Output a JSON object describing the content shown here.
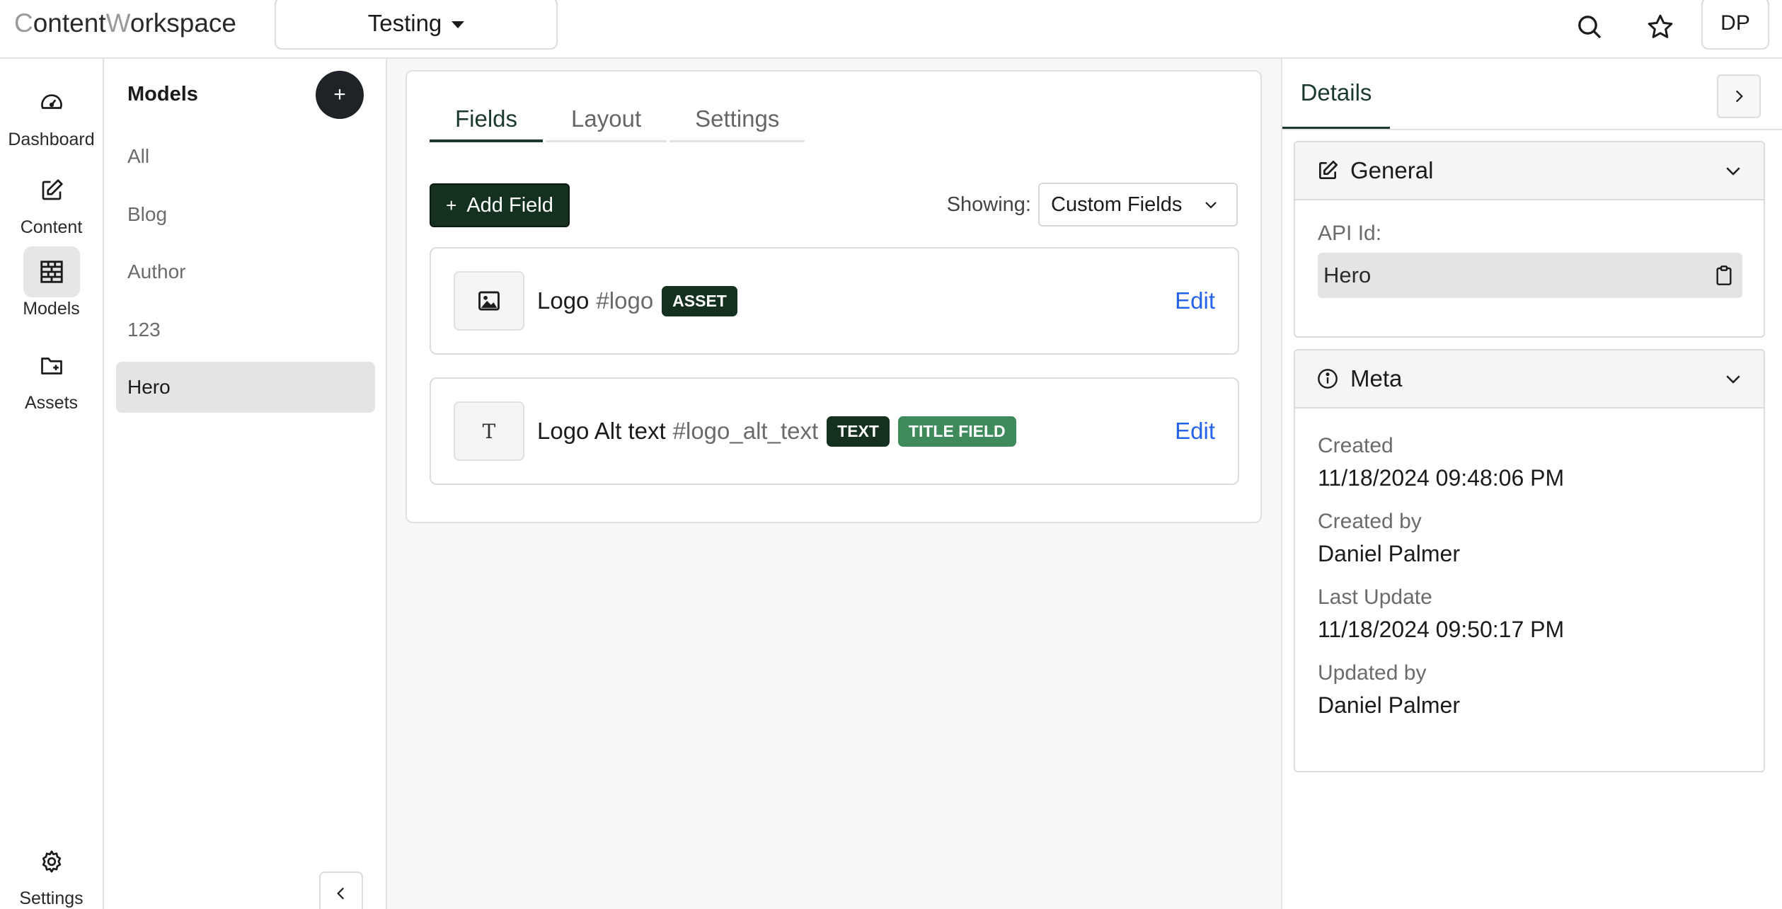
{
  "app": {
    "logo_prefix": "C",
    "logo_mid": "ontent",
    "logo_w": "W",
    "logo_suffix": "orkspace",
    "project": "Testing",
    "avatar_initials": "DP"
  },
  "nav": {
    "dashboard": "Dashboard",
    "content": "Content",
    "models": "Models",
    "assets": "Assets",
    "settings": "Settings"
  },
  "models_panel": {
    "title": "Models",
    "add_label": "+",
    "items": [
      {
        "label": "All"
      },
      {
        "label": "Blog"
      },
      {
        "label": "Author"
      },
      {
        "label": "123"
      },
      {
        "label": "Hero"
      }
    ],
    "active": "Hero"
  },
  "main": {
    "tabs": [
      {
        "label": "Fields"
      },
      {
        "label": "Layout"
      },
      {
        "label": "Settings"
      }
    ],
    "active_tab": "Fields",
    "add_field_plus": "+",
    "add_field_label": "Add Field",
    "showing_label": "Showing:",
    "showing_value": "Custom Fields",
    "fields": [
      {
        "icon": "image-icon",
        "name": "Logo",
        "key": "#logo",
        "badges": [
          "ASSET"
        ],
        "edit": "Edit"
      },
      {
        "icon_text": "T",
        "name": "Logo Alt text",
        "key": "#logo_alt_text",
        "badges": [
          "TEXT",
          "TITLE FIELD"
        ],
        "edit": "Edit"
      }
    ]
  },
  "details": {
    "tab": "Details",
    "general": {
      "title": "General",
      "api_id_label": "API Id:",
      "api_id_value": "Hero"
    },
    "meta": {
      "title": "Meta",
      "created_label": "Created",
      "created_value": "11/18/2024 09:48:06 PM",
      "created_by_label": "Created by",
      "created_by_value": "Daniel Palmer",
      "last_update_label": "Last Update",
      "last_update_value": "11/18/2024 09:50:17 PM",
      "updated_by_label": "Updated by",
      "updated_by_value": "Daniel Palmer"
    }
  },
  "colors": {
    "primary_dark": "#14301f",
    "badge_green": "#3f8a5b",
    "link_blue": "#2563eb"
  }
}
